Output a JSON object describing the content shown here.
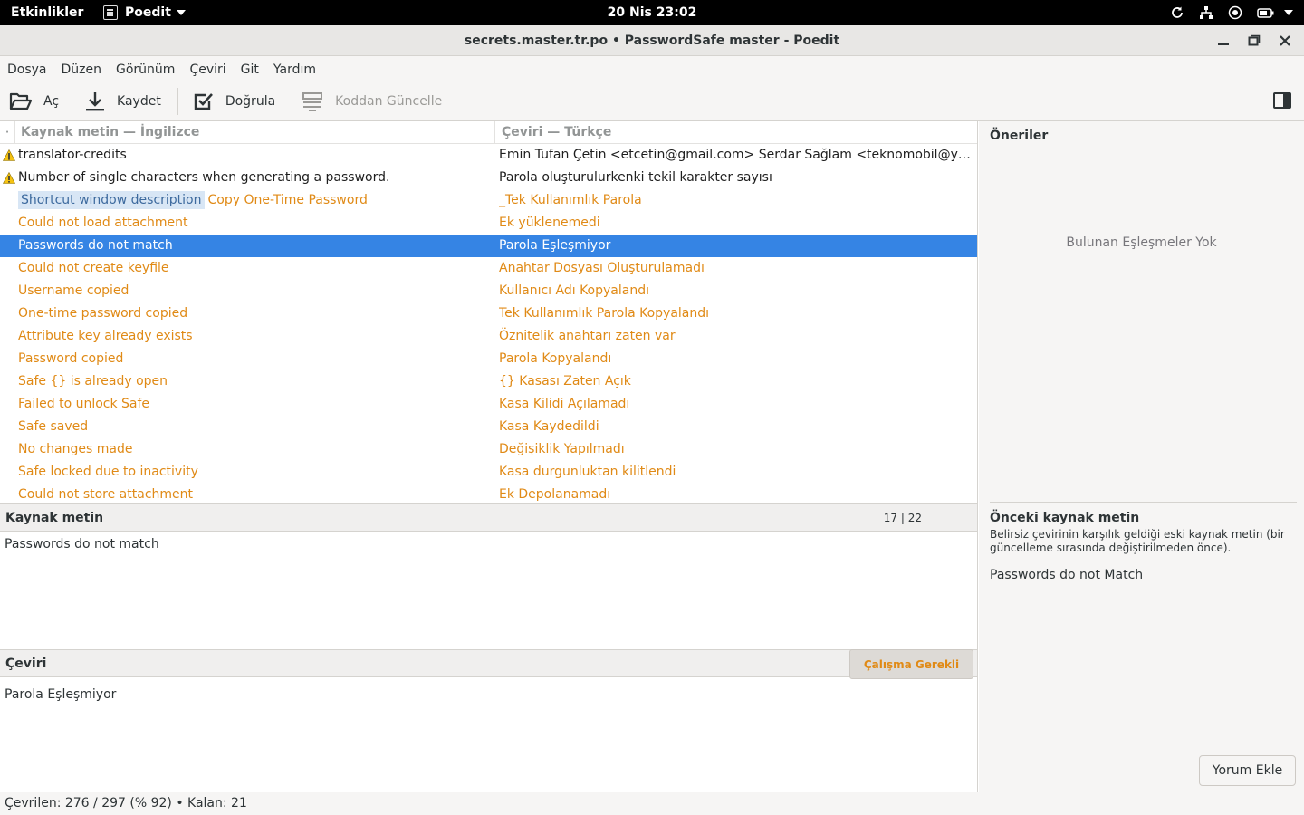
{
  "topbar": {
    "activities": "Etkinlikler",
    "app_name": "Poedit",
    "clock": "20 Nis  23:02"
  },
  "window": {
    "title": "secrets.master.tr.po • PasswordSafe master - Poedit"
  },
  "menu": [
    "Dosya",
    "Düzen",
    "Görünüm",
    "Çeviri",
    "Git",
    "Yardım"
  ],
  "toolbar": {
    "open": "Aç",
    "save": "Kaydet",
    "validate": "Doğrula",
    "update_from_code": "Koddan Güncelle"
  },
  "list": {
    "col_source": "Kaynak metin — İngilizce",
    "col_translation": "Çeviri — Türkçe",
    "rows": [
      {
        "context": "",
        "source": "translator-credits",
        "translation": "Emin Tufan Çetin <etcetin@gmail.com> Serdar Sağlam <teknomobil@yandex.com>",
        "state": "normal",
        "warning": true
      },
      {
        "context": "",
        "source": "Number of single characters when generating a password.",
        "translation": "Parola oluşturulurkenki tekil karakter sayısı",
        "state": "normal",
        "warning": true
      },
      {
        "context": "Shortcut window description",
        "source": "Copy One-Time Password",
        "translation": "_Tek Kullanımlık Parola",
        "state": "fuzzy",
        "warning": false
      },
      {
        "context": "",
        "source": "Could not load attachment",
        "translation": "Ek yüklenemedi",
        "state": "fuzzy",
        "warning": false
      },
      {
        "context": "",
        "source": "Passwords do not match",
        "translation": "Parola Eşleşmiyor",
        "state": "selected",
        "warning": false
      },
      {
        "context": "",
        "source": "Could not create keyfile",
        "translation": "Anahtar Dosyası Oluşturulamadı",
        "state": "fuzzy",
        "warning": false
      },
      {
        "context": "",
        "source": "Username copied",
        "translation": "Kullanıcı Adı Kopyalandı",
        "state": "fuzzy",
        "warning": false
      },
      {
        "context": "",
        "source": "One-time password copied",
        "translation": "Tek Kullanımlık Parola Kopyalandı",
        "state": "fuzzy",
        "warning": false
      },
      {
        "context": "",
        "source": "Attribute key already exists",
        "translation": "Öznitelik anahtarı zaten var",
        "state": "fuzzy",
        "warning": false
      },
      {
        "context": "",
        "source": "Password copied",
        "translation": "Parola Kopyalandı",
        "state": "fuzzy",
        "warning": false
      },
      {
        "context": "",
        "source": "Safe {} is already open",
        "translation": "{} Kasası Zaten Açık",
        "state": "fuzzy",
        "warning": false
      },
      {
        "context": "",
        "source": "Failed to unlock Safe",
        "translation": "Kasa Kilidi Açılamadı",
        "state": "fuzzy",
        "warning": false
      },
      {
        "context": "",
        "source": "Safe saved",
        "translation": "Kasa Kaydedildi",
        "state": "fuzzy",
        "warning": false
      },
      {
        "context": "",
        "source": "No changes made",
        "translation": "Değişiklik Yapılmadı",
        "state": "fuzzy",
        "warning": false
      },
      {
        "context": "",
        "source": "Safe locked due to inactivity",
        "translation": "Kasa durgunluktan kilitlendi",
        "state": "fuzzy",
        "warning": false
      },
      {
        "context": "",
        "source": "Could not store attachment",
        "translation": "Ek Depolanamadı",
        "state": "fuzzy",
        "warning": false
      }
    ]
  },
  "source_panel": {
    "title": "Kaynak metin",
    "counter": "17 | 22",
    "text": "Passwords do not match"
  },
  "translation_panel": {
    "title": "Çeviri",
    "fuzzy_button": "Çalışma Gerekli",
    "text": "Parola Eşleşmiyor"
  },
  "sidebar": {
    "suggestions_title": "Öneriler",
    "no_matches": "Bulunan Eşleşmeler Yok",
    "prev_title": "Önceki kaynak metin",
    "prev_desc": "Belirsiz çevirinin karşılık geldiği eski kaynak metin (bir güncelleme sırasında değiştirilmeden önce).",
    "prev_text": "Passwords do not Match",
    "comment_button": "Yorum Ekle"
  },
  "status": {
    "text": "Çevrilen: 276 / 297 (% 92)  •  Kalan: 21"
  },
  "colors": {
    "fuzzy": "#e08a16",
    "selection": "#3584e4",
    "warning": "#f5c211"
  }
}
